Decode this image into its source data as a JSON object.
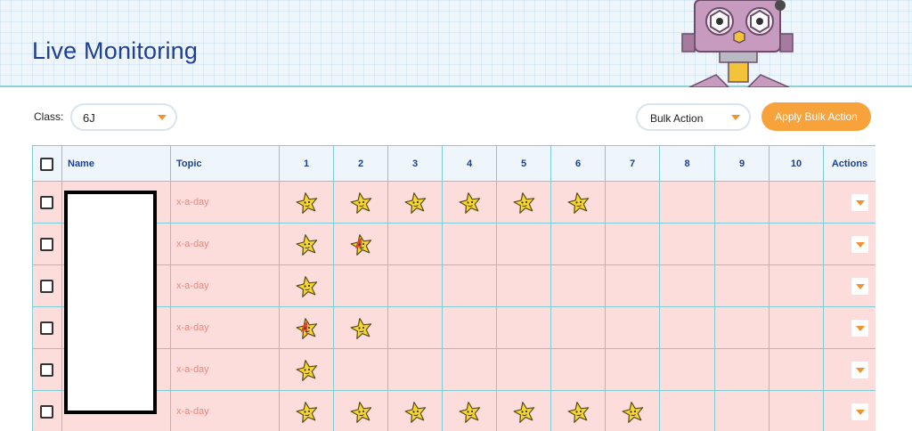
{
  "header": {
    "title": "Live Monitoring"
  },
  "filters": {
    "class_label": "Class:",
    "class_value": "6J",
    "bulk_action_value": "Bulk Action",
    "apply_label": "Apply Bulk Action"
  },
  "table": {
    "headers": {
      "name": "Name",
      "topic": "Topic",
      "actions": "Actions"
    },
    "question_numbers": [
      "1",
      "2",
      "3",
      "4",
      "5",
      "6",
      "7",
      "8",
      "9",
      "10"
    ],
    "rows": [
      {
        "topic": "x-a-day",
        "results": [
          "gold",
          "gold",
          "gold",
          "gold",
          "gold",
          "gold",
          "",
          "",
          "",
          ""
        ]
      },
      {
        "topic": "x-a-day",
        "results": [
          "gold",
          "red",
          "",
          "",
          "",
          "",
          "",
          "",
          "",
          ""
        ]
      },
      {
        "topic": "x-a-day",
        "results": [
          "gold",
          "",
          "",
          "",
          "",
          "",
          "",
          "",
          "",
          ""
        ]
      },
      {
        "topic": "x-a-day",
        "results": [
          "red",
          "gold",
          "",
          "",
          "",
          "",
          "",
          "",
          "",
          ""
        ]
      },
      {
        "topic": "x-a-day",
        "results": [
          "gold",
          "",
          "",
          "",
          "",
          "",
          "",
          "",
          "",
          ""
        ]
      },
      {
        "topic": "x-a-day",
        "results": [
          "gold",
          "gold",
          "gold",
          "gold",
          "gold",
          "gold",
          "gold",
          "",
          "",
          ""
        ]
      }
    ]
  },
  "colors": {
    "title": "#1f3f8f",
    "accent": "#f7a23b",
    "row_bg": "#fddcdc",
    "grid_line": "#7fcbd6",
    "topic_text": "#e88b7c",
    "star_gold": "#f6d62a",
    "star_red": "#e0452f"
  },
  "icons": {
    "star": "star-icon",
    "caret": "chevron-down-icon",
    "checkbox": "checkbox-icon"
  }
}
